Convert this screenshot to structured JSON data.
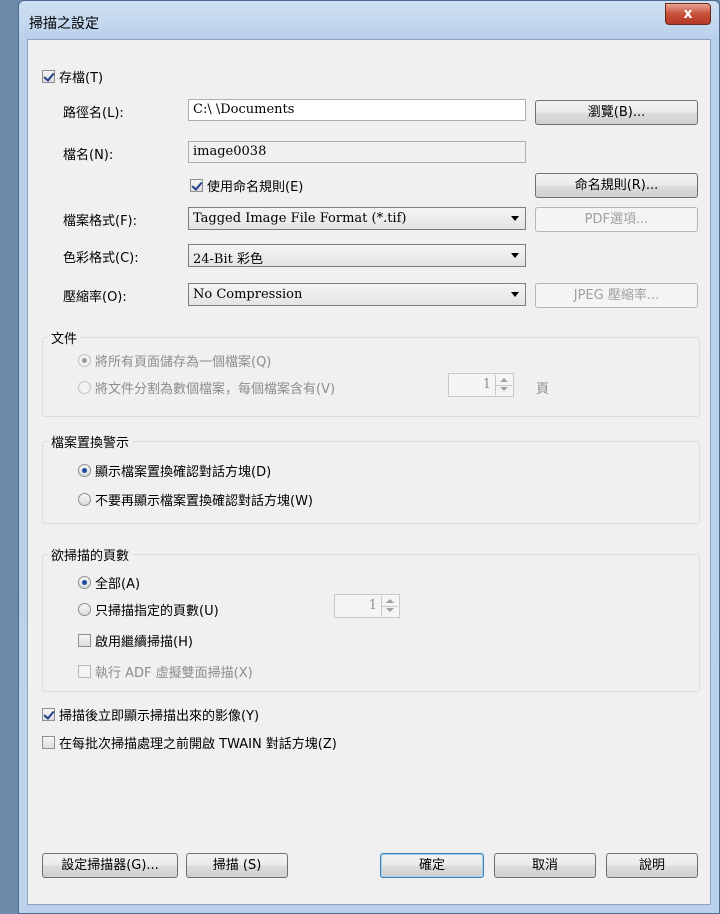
{
  "window": {
    "title": "掃描之設定",
    "close_label": "x"
  },
  "save": {
    "checkbox_label": "存檔(T)",
    "checked": true,
    "path_label": "路徑名(L):",
    "path_value": "C:\\                              \\Documents",
    "browse_label": "瀏覽(B)...",
    "filename_label": "檔名(N):",
    "filename_value": "image0038",
    "use_naming_label": "使用命名規則(E)",
    "naming_rules_label": "命名規則(R)...",
    "format_label": "檔案格式(F):",
    "format_value": "Tagged Image File Format (*.tif)",
    "pdf_options_label": "PDF選項...",
    "color_label": "色彩格式(C):",
    "color_value": "24-Bit 彩色",
    "compression_label": "壓縮率(O):",
    "compression_value": "No Compression",
    "jpeg_label": "JPEG 壓縮率..."
  },
  "document_group": {
    "title": "文件",
    "option_single": "將所有頁面儲存為一個檔案(Q)",
    "option_split": "將文件分割為數個檔案，每個檔案含有(V)",
    "pages_value": "1",
    "pages_unit": "頁"
  },
  "overwrite_group": {
    "title": "檔案置換警示",
    "option_show": "顯示檔案置換確認對話方塊(D)",
    "option_hide": "不要再顯示檔案置換確認對話方塊(W)"
  },
  "pages_group": {
    "title": "欲掃描的頁數",
    "option_all": "全部(A)",
    "option_specific": "只掃描指定的頁數(U)",
    "count_value": "1",
    "continuous_label": "啟用繼續掃描(H)",
    "adf_label": "執行 ADF 虛擬雙面掃描(X)"
  },
  "options": {
    "show_image_label": "掃描後立即顯示掃描出來的影像(Y)",
    "twain_label": "在每批次掃描處理之前開啟 TWAIN 對話方塊(Z)"
  },
  "buttons": {
    "scanner_setup": "設定掃描器(G)...",
    "scan": "掃描 (S)",
    "ok": "確定",
    "cancel": "取消",
    "help": "說明"
  }
}
